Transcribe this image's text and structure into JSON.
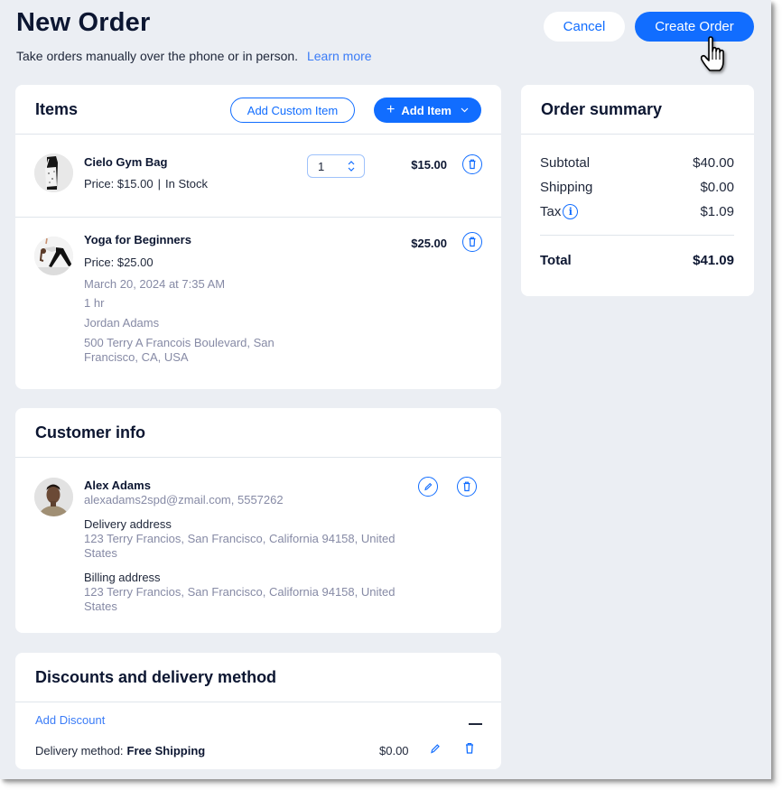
{
  "header": {
    "title": "New Order",
    "subtitle": "Take orders manually over the phone or in person.",
    "learn_more": "Learn more",
    "cancel_label": "Cancel",
    "create_label": "Create Order"
  },
  "colors": {
    "primary": "#116dff",
    "page_background": "#ebeef3",
    "text_primary": "#0c1631",
    "text_muted": "#868aa5",
    "link": "#3b7cf7"
  },
  "items": {
    "title": "Items",
    "add_custom_label": "Add Custom Item",
    "add_item_label": "Add Item",
    "add_item_icon": "plus-icon",
    "add_item_dropdown_icon": "chevron-down-icon",
    "list": [
      {
        "name": "Cielo Gym Bag",
        "price_line": "Price: $15.00",
        "stock": "In Stock",
        "quantity": "1",
        "total": "$15.00",
        "delete_icon": "trash-icon"
      },
      {
        "name": "Yoga for Beginners",
        "price_line": "Price: $25.00",
        "datetime": "March 20, 2024 at 7:35 AM",
        "duration": "1 hr",
        "staff": "Jordan Adams",
        "location": "500 Terry A Francois Boulevard, San Francisco, CA, USA",
        "total": "$25.00",
        "delete_icon": "trash-icon"
      }
    ]
  },
  "summary": {
    "title": "Order summary",
    "rows": [
      {
        "label": "Subtotal",
        "value": "$40.00"
      },
      {
        "label": "Shipping",
        "value": "$0.00"
      },
      {
        "label": "Tax",
        "value": "$1.09",
        "icon": "info-icon"
      }
    ],
    "total_label": "Total",
    "total_value": "$41.09",
    "info_glyph": "i"
  },
  "customer": {
    "title": "Customer info",
    "name": "Alex Adams",
    "contact": "alexadams2spd@zmail.com, 5557262",
    "delivery_label": "Delivery address",
    "delivery_address": "123 Terry Francios, San Francisco, California 94158, United States",
    "billing_label": "Billing address",
    "billing_address": "123 Terry Francios, San Francisco, California 94158, United States"
  },
  "discounts": {
    "title": "Discounts and delivery method",
    "add_discount": "Add Discount",
    "delivery_label": "Delivery method:",
    "delivery_method": "Free Shipping",
    "delivery_price": "$0.00"
  }
}
